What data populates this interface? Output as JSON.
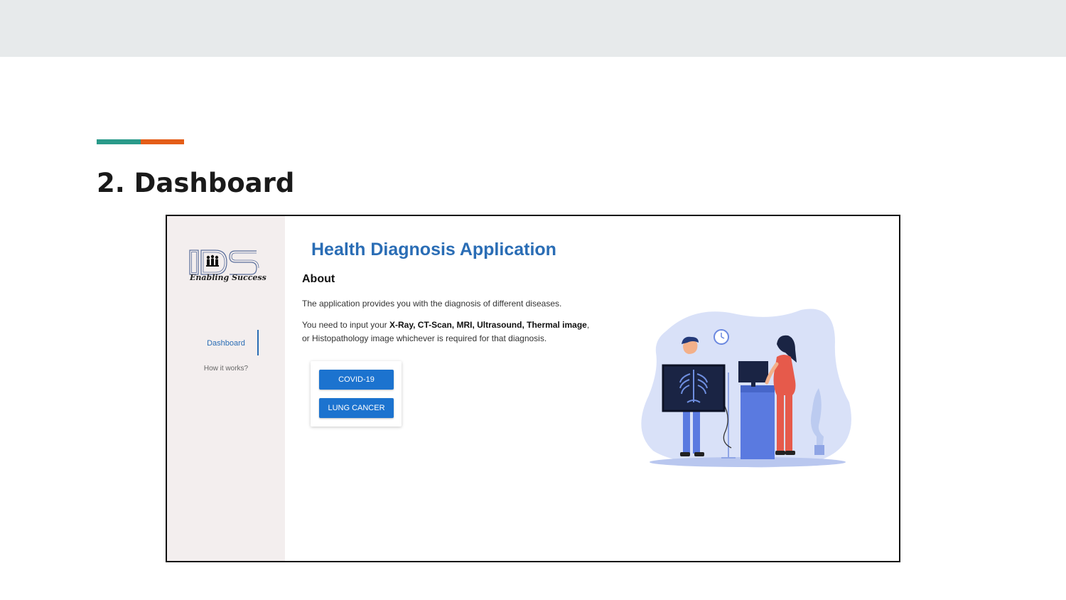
{
  "slide": {
    "title": "2. Dashboard",
    "accent_colors": [
      "#2a9a8a",
      "#e45d18"
    ]
  },
  "app": {
    "sidebar": {
      "logo_text": "Enabling Success",
      "nav": [
        {
          "label": "Dashboard",
          "active": true
        },
        {
          "label": "How it works?",
          "active": false
        }
      ]
    },
    "main": {
      "title": "Health Diagnosis Application",
      "about_heading": "About",
      "paragraph1": "The application provides you with the diagnosis of different diseases.",
      "paragraph2_segments": [
        "You need to input your ",
        "X-Ray, CT-Scan, MRI, Ultrasound, Thermal image",
        ", or Histopathology image whichever is required for that diagnosis."
      ],
      "buttons": {
        "covid": "COVID-19",
        "lung_cancer": "LUNG CANCER"
      }
    },
    "colors": {
      "accent_blue": "#2a6db5",
      "button_blue": "#1c73cf",
      "sidebar_bg": "#f3eeee"
    },
    "illustration": "doctor-xray-illustration"
  }
}
